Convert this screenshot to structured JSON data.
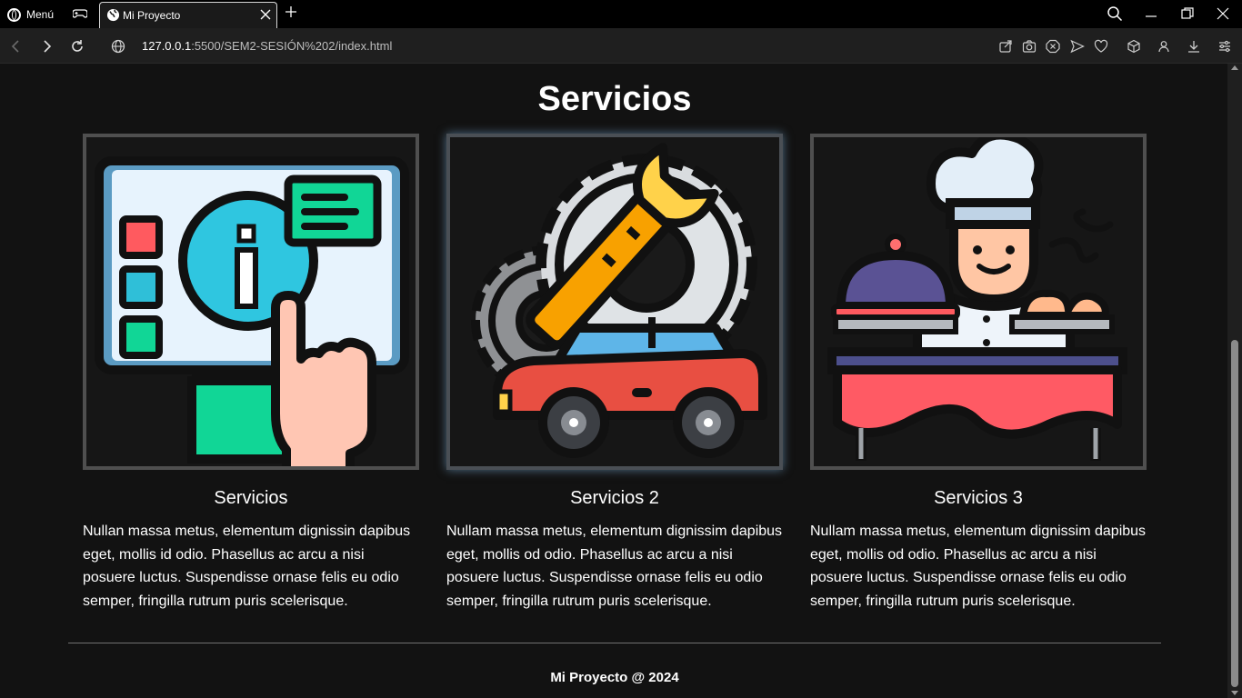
{
  "browser": {
    "menu_label": "Menú",
    "tab_title": "Mi Proyecto",
    "url_host": "127.0.0.1",
    "url_path": ":5500/SEM2-SESIÓN%202/index.html"
  },
  "page": {
    "section_title": "Servicios",
    "cards": [
      {
        "title": "Servicios",
        "icon": "information-touchscreen-icon",
        "text": "Nullan massa metus, elementum dignissin dapibus eget, mollis id odio. Phasellus ac arcu a nisi posuere luctus. Suspendisse ornase felis eu odio semper, fringilla rutrum puris scelerisque."
      },
      {
        "title": "Servicios 2",
        "icon": "car-repair-gears-icon",
        "text": "Nullam massa metus, elementum dignissim dapibus eget, mollis od odio. Phasellus ac arcu a nisi posuere luctus. Suspendisse ornase felis eu odio semper, fringilla rutrum puris scelerisque."
      },
      {
        "title": "Servicios 3",
        "icon": "chef-catering-icon",
        "text": "Nullam massa metus, elementum dignissim dapibus eget, mollis od odio. Phasellus ac arcu a nisi posuere luctus. Suspendisse ornase felis eu odio semper, fringilla rutrum puris scelerisque."
      }
    ],
    "footer": "Mi Proyecto @ 2024"
  },
  "colors": {
    "background": "#121212",
    "card_border": "#4f4f4f",
    "text": "#ffffff"
  }
}
